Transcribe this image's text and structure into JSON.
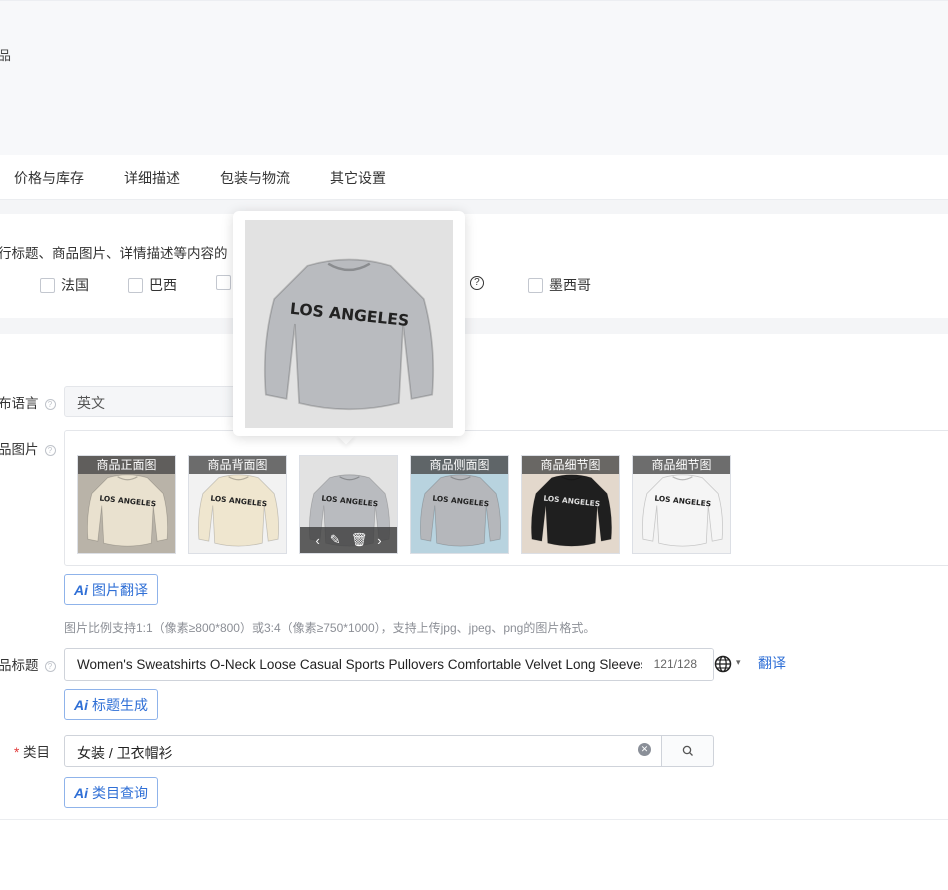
{
  "header": {
    "title": "品"
  },
  "tabs": [
    {
      "label": "价格与库存"
    },
    {
      "label": "详细描述"
    },
    {
      "label": "包装与物流"
    },
    {
      "label": "其它设置"
    }
  ],
  "translation_section": {
    "description": "行标题、商品图片、详情描述等内容的",
    "countries": [
      {
        "label": "法国",
        "checked": false
      },
      {
        "label": "巴西",
        "checked": false
      },
      {
        "label": "",
        "checked": false
      },
      {
        "label": "墨西哥",
        "checked": false
      }
    ],
    "partial_label": "]"
  },
  "form": {
    "language_label": "布语言",
    "language_value": "英文",
    "images_label": "品图片",
    "images": [
      {
        "label": "商品正面图",
        "bg": "#b9b3a8",
        "shirt": "#e9e1cf"
      },
      {
        "label": "商品背面图",
        "bg": "#f2f2f2",
        "shirt": "#efe6cf"
      },
      {
        "label": "",
        "bg": "#e2e2e2",
        "shirt": "#b9bbbf"
      },
      {
        "label": "商品侧面图",
        "bg": "#b8d3df",
        "shirt": "#b5b7bb"
      },
      {
        "label": "商品细节图",
        "bg": "#e3d8cc",
        "shirt": "#1f1f1f"
      },
      {
        "label": "商品细节图",
        "bg": "#f3f3f3",
        "shirt": "#f5f5f5"
      }
    ],
    "shirt_text": "LOS ANGELES",
    "image_tools": {
      "prev": "‹",
      "edit": "✎",
      "delete": "🗑",
      "next": "›"
    },
    "image_translate_btn": "图片翻译",
    "image_hint": "图片比例支持1:1（像素≥800*800）或3:4（像素≥750*1000），支持上传jpg、jpeg、png的图片格式。",
    "title_label": "品标题",
    "title_value": "Women's Sweatshirts O-Neck Loose Casual Sports Pullovers Comfortable Velvet Long Sleeves",
    "title_count": "121/128",
    "translate_link": "翻译",
    "title_gen_btn": "标题生成",
    "category_required": "*",
    "category_label": "类目",
    "category_value": "女装 / 卫衣帽衫",
    "category_query_btn": "类目查询",
    "ai_icon": "Ai"
  },
  "colors": {
    "accent": "#2f6fd6",
    "border": "#cfd3da",
    "required": "#e23b3b"
  }
}
